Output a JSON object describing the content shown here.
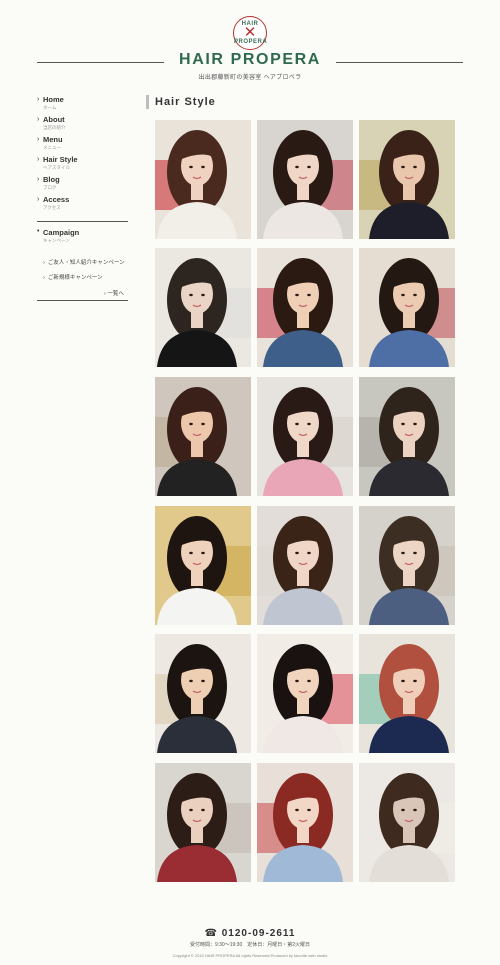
{
  "header": {
    "logo_top": "HAIR",
    "logo_mark": "✕",
    "logo_bottom": "PROPERA",
    "title": "HAIR PROPERA",
    "subtitle": "出出郡藤新町の美容室 ヘアプロペラ"
  },
  "sidebar": {
    "items": [
      {
        "label": "Home",
        "sub": "ホーム"
      },
      {
        "label": "About",
        "sub": "当店の紹介"
      },
      {
        "label": "Menu",
        "sub": "メニュー"
      },
      {
        "label": "Hair Style",
        "sub": "ヘアスタイル"
      },
      {
        "label": "Blog",
        "sub": "ブログ"
      },
      {
        "label": "Access",
        "sub": "アクセス"
      }
    ],
    "campaign": {
      "label": "Campaign",
      "sub": "キャンペーン",
      "links": [
        "ご友人・知人紹介キャンペーン",
        "ご新規様キャンペーン"
      ],
      "more": "一覧へ"
    }
  },
  "main": {
    "section_title": "Hair Style",
    "photos": [
      {
        "name": "hairstyle-photo-1",
        "bg": "#e9e3da",
        "hair": "#4a2a1e",
        "skin": "#efd2bf",
        "cloth": "#f2efe9",
        "accent": "#c9202a"
      },
      {
        "name": "hairstyle-photo-2",
        "bg": "#d8d5d0",
        "hair": "#2a1a14",
        "skin": "#f0d6c6",
        "cloth": "#ece7e2",
        "accent": "#c74553"
      },
      {
        "name": "hairstyle-photo-3",
        "bg": "#d9d3b5",
        "hair": "#3b2218",
        "skin": "#e9c7ad",
        "cloth": "#1e1e2a",
        "accent": "#b9a45a"
      },
      {
        "name": "hairstyle-photo-4",
        "bg": "#ebe7e1",
        "hair": "#2d2620",
        "skin": "#ead4c6",
        "cloth": "#151515",
        "accent": "#dcdcdc"
      },
      {
        "name": "hairstyle-photo-5",
        "bg": "#e8e2da",
        "hair": "#2b1a12",
        "skin": "#efcfb6",
        "cloth": "#3d5f8a",
        "accent": "#c8354a"
      },
      {
        "name": "hairstyle-photo-6",
        "bg": "#e5ddd2",
        "hair": "#241812",
        "skin": "#eccbb3",
        "cloth": "#4e6fa5",
        "accent": "#c04a55"
      },
      {
        "name": "hairstyle-photo-7",
        "bg": "#cfc7bd",
        "hair": "#3a2018",
        "skin": "#ecc7ab",
        "cloth": "#222",
        "accent": "#b9a98f"
      },
      {
        "name": "hairstyle-photo-8",
        "bg": "#e6e2dd",
        "hair": "#2a1a15",
        "skin": "#f0d8c8",
        "cloth": "#e9a6b6",
        "accent": "#d5cfc9"
      },
      {
        "name": "hairstyle-photo-9",
        "bg": "#c7c6bf",
        "hair": "#2f241c",
        "skin": "#ecd2c0",
        "cloth": "#2a2a30",
        "accent": "#a7a59c"
      },
      {
        "name": "hairstyle-photo-10",
        "bg": "#e0c98a",
        "hair": "#1e1410",
        "skin": "#efd2bc",
        "cloth": "#f4f4f2",
        "accent": "#c9a446"
      },
      {
        "name": "hairstyle-photo-11",
        "bg": "#e2ddd8",
        "hair": "#3a2418",
        "skin": "#efd6c6",
        "cloth": "#bfc6d2",
        "accent": "#dcd7d1"
      },
      {
        "name": "hairstyle-photo-12",
        "bg": "#d5d1cb",
        "hair": "#3d2e24",
        "skin": "#ecd5c4",
        "cloth": "#4c5f80",
        "accent": "#c7bfb4"
      },
      {
        "name": "hairstyle-photo-13",
        "bg": "#ede9e2",
        "hair": "#1c1410",
        "skin": "#efcfb4",
        "cloth": "#2b2f3a",
        "accent": "#d7c6a8"
      },
      {
        "name": "hairstyle-photo-14",
        "bg": "#f1ede6",
        "hair": "#1a1210",
        "skin": "#f1d4bd",
        "cloth": "#f0e8e4",
        "accent": "#d94556"
      },
      {
        "name": "hairstyle-photo-15",
        "bg": "#e8e4dc",
        "hair": "#b1503e",
        "skin": "#efcfb9",
        "cloth": "#1c2a52",
        "accent": "#6bbca3"
      },
      {
        "name": "hairstyle-photo-16",
        "bg": "#d9d6d0",
        "hair": "#2c1d16",
        "skin": "#ead0bf",
        "cloth": "#9a2c34",
        "accent": "#bfb8ad"
      },
      {
        "name": "hairstyle-photo-17",
        "bg": "#e8dfd8",
        "hair": "#8a2a22",
        "skin": "#f2d6c6",
        "cloth": "#9fb9d6",
        "accent": "#c94b4b"
      },
      {
        "name": "hairstyle-photo-18",
        "bg": "#ece9e4",
        "hair": "#3e2a1e",
        "skin": "#d9c6b8",
        "cloth": "#e3ded7",
        "accent": "#f3efe6"
      }
    ]
  },
  "footer": {
    "tel": "☎ 0120-09-2611",
    "hours": "受付時間：9:30〜19:30　定休日：月曜日・第2火曜日",
    "copyright": "Copyright © 2015 HAIR PROPERA All rights Reserved.Produced by favorite web studio"
  }
}
